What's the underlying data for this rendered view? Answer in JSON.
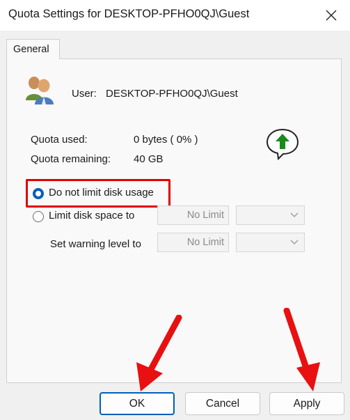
{
  "window": {
    "title": "Quota Settings for DESKTOP-PFHO0QJ\\Guest"
  },
  "tabs": [
    {
      "label": "General"
    }
  ],
  "user": {
    "label": "User:",
    "name": "DESKTOP-PFHO0QJ\\Guest"
  },
  "quota": {
    "used_label": "Quota used:",
    "used_value": "0 bytes ( 0% )",
    "remaining_label": "Quota remaining:",
    "remaining_value": "40 GB"
  },
  "options": {
    "no_limit_label": "Do not limit disk usage",
    "limit_label": "Limit disk space to",
    "warning_label": "Set warning level to",
    "limit_value": "No Limit",
    "warning_value": "No Limit",
    "selected": "no_limit"
  },
  "buttons": {
    "ok": "OK",
    "cancel": "Cancel",
    "apply": "Apply"
  },
  "colors": {
    "highlight": "#e00000",
    "accent": "#005fb8",
    "status_ok": "#1a8a1a"
  },
  "icons": [
    "users-icon",
    "status-ok-arrow-icon",
    "close-icon",
    "chevron-down-icon"
  ]
}
